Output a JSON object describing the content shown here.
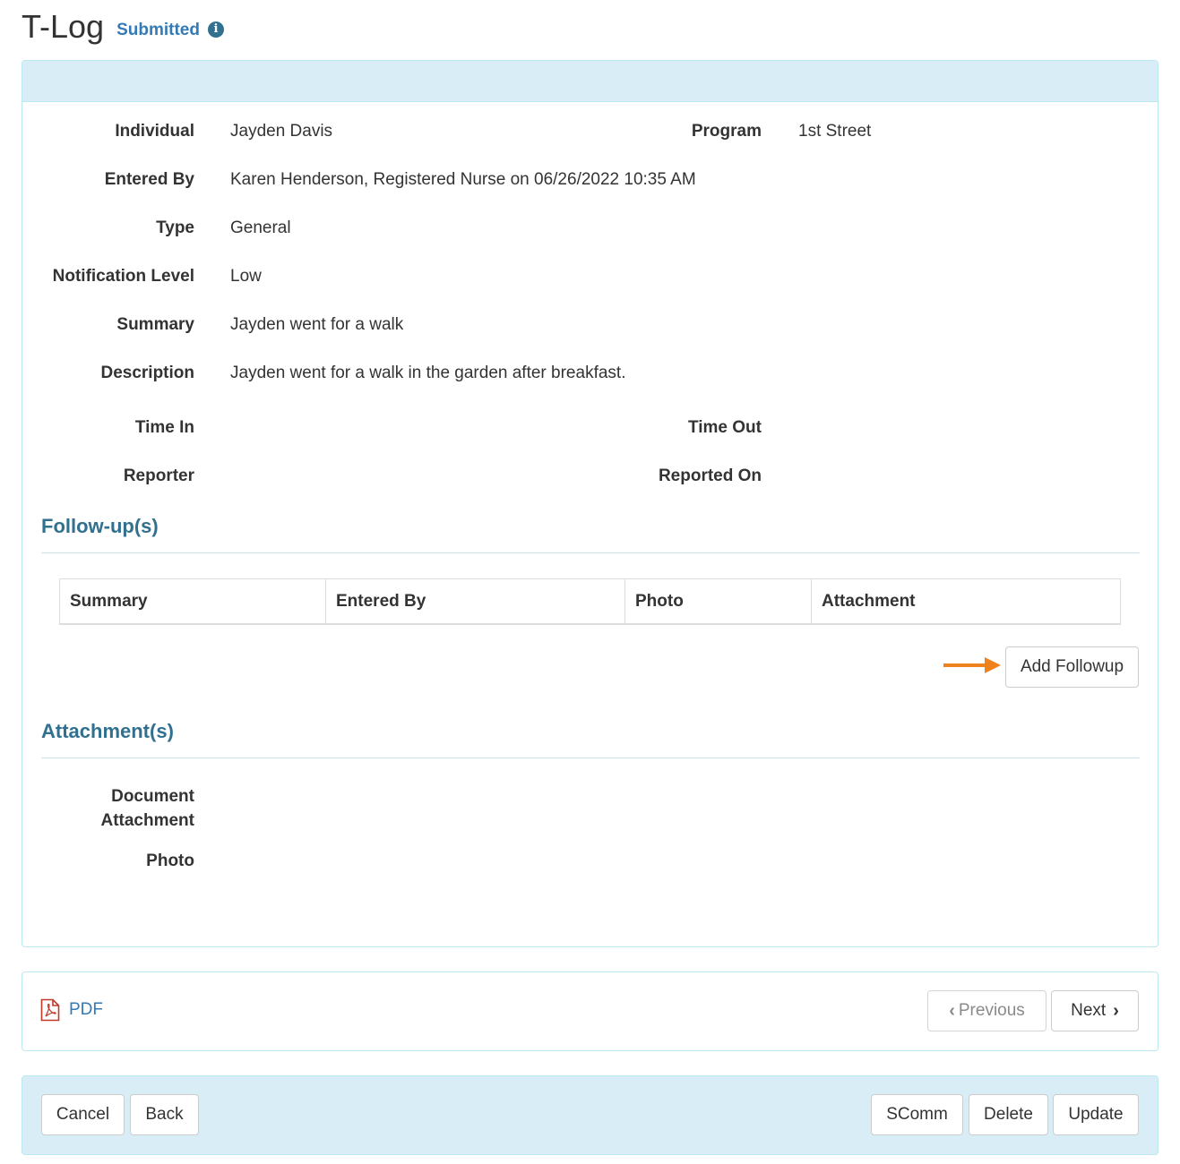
{
  "header": {
    "title": "T-Log",
    "status": "Submitted",
    "info_icon": "info-circle-icon"
  },
  "details": {
    "individual_label": "Individual",
    "individual_value": "Jayden Davis",
    "program_label": "Program",
    "program_value": "1st Street",
    "entered_by_label": "Entered By",
    "entered_by_value": "Karen Henderson, Registered Nurse on 06/26/2022 10:35 AM",
    "type_label": "Type",
    "type_value": "General",
    "notification_label": "Notification Level",
    "notification_value": "Low",
    "summary_label": "Summary",
    "summary_value": "Jayden went for a walk",
    "description_label": "Description",
    "description_value": "Jayden went for a walk in the garden after breakfast.",
    "time_in_label": "Time In",
    "time_out_label": "Time Out",
    "reporter_label": "Reporter",
    "reported_on_label": "Reported On"
  },
  "followups": {
    "title": "Follow-up(s)",
    "columns": [
      "Summary",
      "Entered By",
      "Photo",
      "Attachment"
    ],
    "add_button": "Add Followup",
    "arrow_color": "#f0821e"
  },
  "attachments": {
    "title": "Attachment(s)",
    "document_label_line1": "Document",
    "document_label_line2": "Attachment",
    "photo_label": "Photo"
  },
  "nav": {
    "pdf_label": "PDF",
    "pdf_icon": "file-pdf-icon",
    "previous_label": "Previous",
    "next_label": "Next"
  },
  "footer": {
    "cancel_label": "Cancel",
    "back_label": "Back",
    "scomm_label": "SComm",
    "delete_label": "Delete",
    "update_label": "Update"
  },
  "colors": {
    "panel_heading_bg": "#d9edf7",
    "panel_border": "#bce8f1",
    "section_title": "#31708f",
    "link": "#337ab7",
    "status": "#337ab7"
  }
}
